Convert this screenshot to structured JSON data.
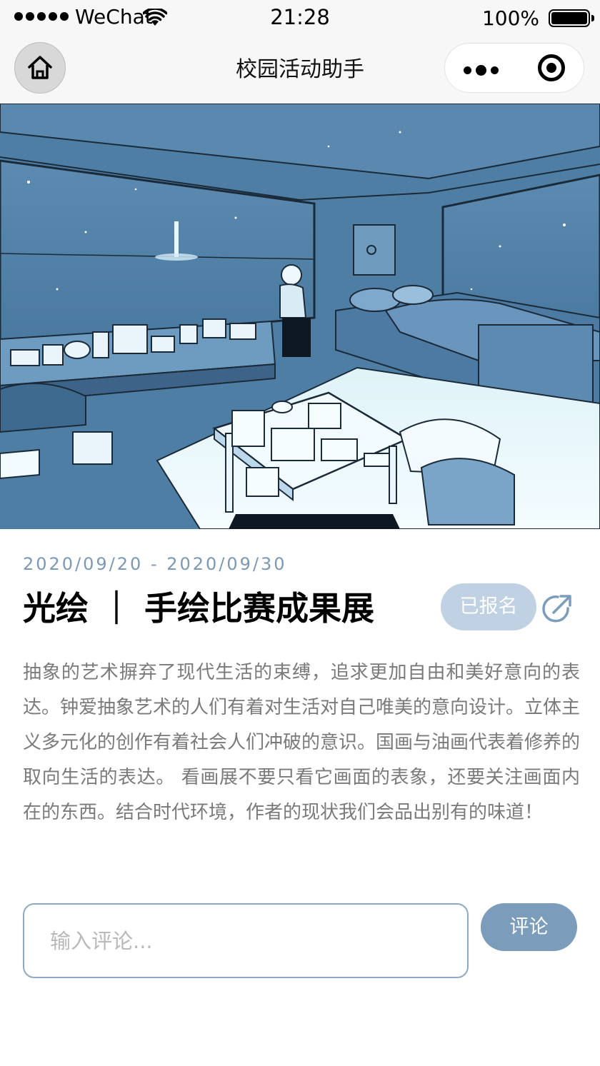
{
  "status_bar": {
    "carrier": "WeChat",
    "time": "21:28",
    "battery": "100%",
    "icons": [
      "signal-dots-icon",
      "wifi-icon",
      "battery-icon"
    ]
  },
  "nav": {
    "title": "校园活动助手",
    "icons": [
      "home-icon",
      "more-dots-icon",
      "target-icon"
    ]
  },
  "hero": {
    "image": "illustration-bedroom-night-sky"
  },
  "activity": {
    "date_range": "2020/09/20 - 2020/09/30",
    "title": "光绘 ｜ 手绘比赛成果展",
    "status": "已报名",
    "description": "抽象的艺术摒弃了现代生活的束缚，追求更加自由和美好意向的表达。钟爱抽象艺术的人们有着对生活对自己唯美的意向设计。立体主义多元化的创作有着社会人们冲破的意识。国画与油画代表着修养的取向生活的表达。 看画展不要只看它画面的表象，还要关注画面内在的东西。结合时代环境，作者的现状我们会品出别有的味道！"
  },
  "comment": {
    "placeholder": "输入评论...",
    "value": "",
    "button": "评论"
  },
  "colors": {
    "accent": "#7b9cbb",
    "badge": "#c0d1e3",
    "date": "#7b98b6",
    "description": "#7a7a7a"
  }
}
